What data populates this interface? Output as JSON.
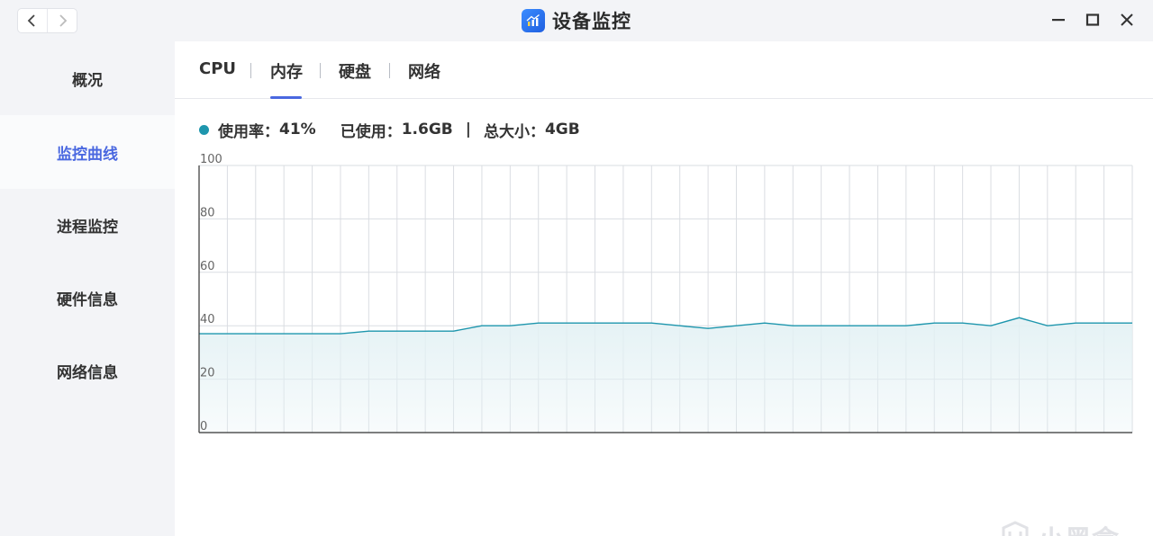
{
  "window": {
    "title": "设备监控",
    "icons": {
      "back": "chevron-left-icon",
      "forward": "chevron-right-icon",
      "app": "chart-app-icon",
      "minimize": "minimize-icon",
      "maximize": "maximize-icon",
      "close": "close-icon"
    }
  },
  "sidebar": {
    "items": [
      {
        "label": "概况",
        "active": false
      },
      {
        "label": "监控曲线",
        "active": true
      },
      {
        "label": "进程监控",
        "active": false
      },
      {
        "label": "硬件信息",
        "active": false
      },
      {
        "label": "网络信息",
        "active": false
      }
    ]
  },
  "tabs": [
    {
      "label": "CPU",
      "active": false
    },
    {
      "label": "内存",
      "active": true
    },
    {
      "label": "硬盘",
      "active": false
    },
    {
      "label": "网络",
      "active": false
    }
  ],
  "stats": {
    "usage_label": "使用率：",
    "usage_value": "41%",
    "used_label": "已使用：",
    "used_value": "1.6GB",
    "separator": "|",
    "total_label": "总大小：",
    "total_value": "4GB"
  },
  "colors": {
    "accent": "#4a68e0",
    "line": "#1e96ad",
    "fill": "#e3f1f4"
  },
  "chart_data": {
    "type": "area",
    "title": "",
    "xlabel": "",
    "ylabel": "",
    "ylim": [
      0,
      100
    ],
    "yticks": [
      "0",
      "20",
      "40",
      "60",
      "80",
      "100"
    ],
    "grid": true,
    "x": [
      0,
      5,
      10,
      15,
      20,
      25,
      30,
      35,
      40,
      45,
      50,
      55,
      60,
      65,
      70,
      75,
      80,
      85,
      90,
      95,
      100,
      105,
      110,
      115,
      120,
      125,
      130,
      135,
      140,
      145,
      150,
      155,
      160,
      165
    ],
    "values": [
      37,
      37,
      37,
      37,
      37,
      37,
      38,
      38,
      38,
      38,
      40,
      40,
      41,
      41,
      41,
      41,
      41,
      40,
      39,
      40,
      41,
      40,
      40,
      40,
      40,
      40,
      41,
      41,
      40,
      43,
      40,
      41,
      41,
      41
    ]
  },
  "watermark": {
    "text": "小黑盒",
    "icon": "heybox-logo-icon"
  }
}
